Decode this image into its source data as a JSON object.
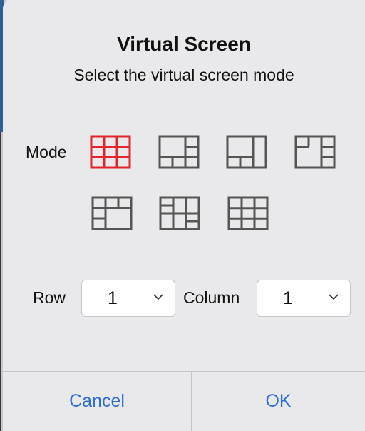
{
  "dialog": {
    "title": "Virtual Screen",
    "subtitle": "Select the virtual screen mode"
  },
  "mode": {
    "label": "Mode",
    "options": [
      {
        "name": "grid-3x3",
        "selected": true
      },
      {
        "name": "large-top-left-3-bottom-1-right",
        "selected": false
      },
      {
        "name": "large-top-left-2-bottom",
        "selected": false
      },
      {
        "name": "large-bottom-left-top-right-split",
        "selected": false
      },
      {
        "name": "top-row-split-large-bottom",
        "selected": false
      },
      {
        "name": "grid-split-variant",
        "selected": false
      },
      {
        "name": "grid-3x3-alt",
        "selected": false
      }
    ],
    "selected_color": "#e0262f",
    "icon_color": "#555555"
  },
  "row": {
    "label": "Row",
    "value": "1"
  },
  "column": {
    "label": "Column",
    "value": "1"
  },
  "buttons": {
    "cancel": "Cancel",
    "ok": "OK"
  },
  "colors": {
    "accent": "#2d6cd6"
  }
}
